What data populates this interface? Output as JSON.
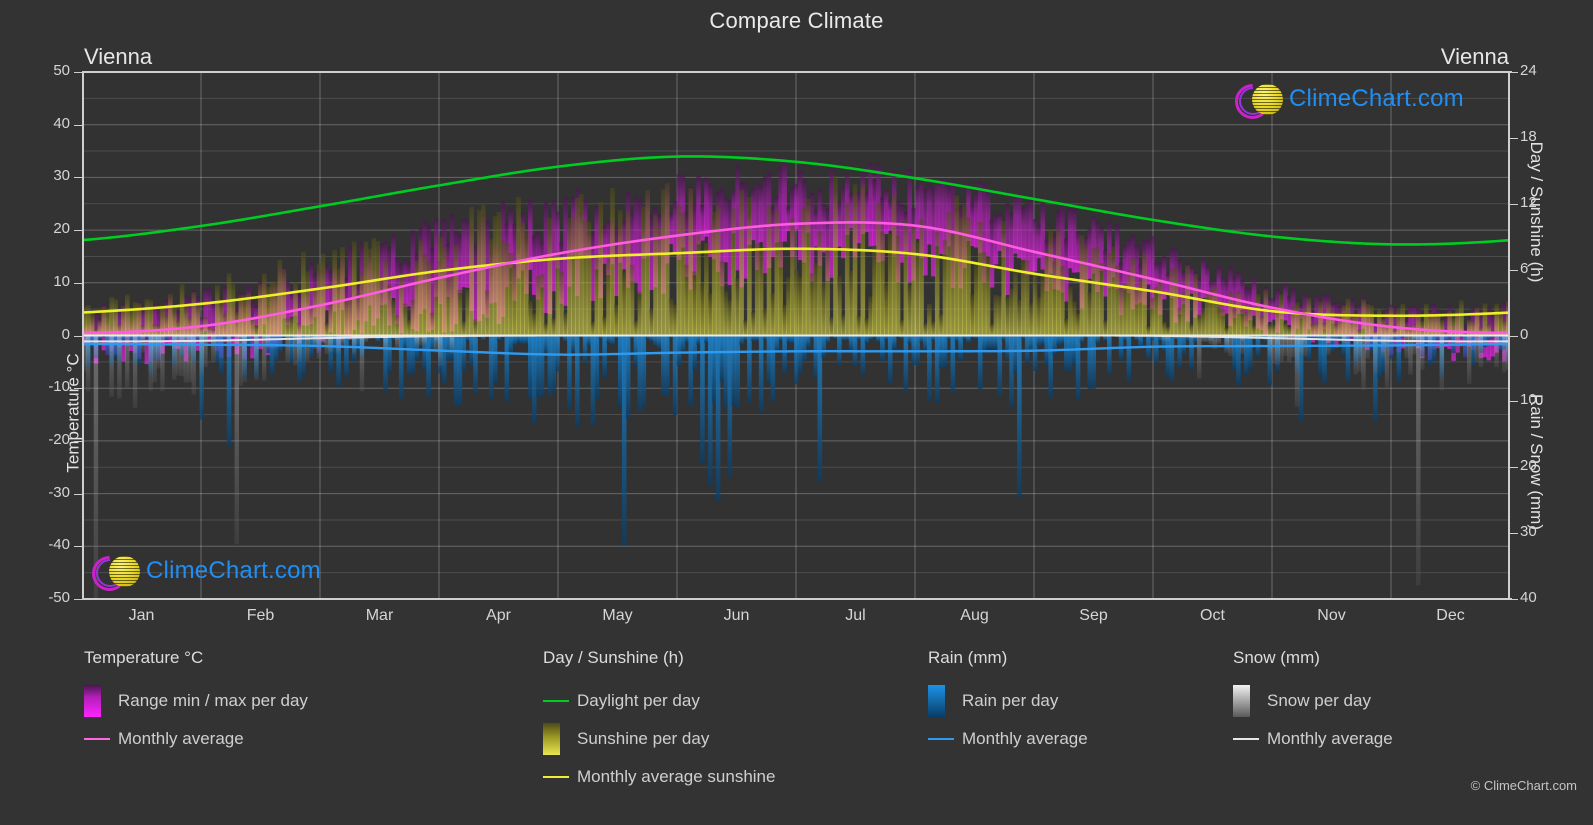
{
  "header": {
    "title": "Compare Climate",
    "city_left": "Vienna",
    "city_right": "Vienna"
  },
  "axes": {
    "left_label": "Temperature °C",
    "right_label_top": "Day / Sunshine (h)",
    "right_label_bottom": "Rain / Snow (mm)",
    "left_ticks": [
      "50",
      "40",
      "30",
      "20",
      "10",
      "0",
      "-10",
      "-20",
      "-30",
      "-40",
      "-50"
    ],
    "right_ticks_top": [
      "24",
      "18",
      "12",
      "6",
      "0"
    ],
    "right_ticks_bottom": [
      "0",
      "10",
      "20",
      "30",
      "40"
    ],
    "x_ticks": [
      "Jan",
      "Feb",
      "Mar",
      "Apr",
      "May",
      "Jun",
      "Jul",
      "Aug",
      "Sep",
      "Oct",
      "Nov",
      "Dec"
    ]
  },
  "legend": {
    "groups": [
      {
        "title": "Temperature °C",
        "items": [
          {
            "label": "Range min / max per day",
            "key": "swatch",
            "color": "#ff00ff"
          },
          {
            "label": "Monthly average",
            "key": "line",
            "color": "#ff66e0"
          }
        ]
      },
      {
        "title": "Day / Sunshine (h)",
        "items": [
          {
            "label": "Daylight per day",
            "key": "line",
            "color": "#00cc22"
          },
          {
            "label": "Sunshine per day",
            "key": "swatch",
            "color": "#ecea44"
          },
          {
            "label": "Monthly average sunshine",
            "key": "line",
            "color": "#eeee33"
          }
        ]
      },
      {
        "title": "Rain (mm)",
        "items": [
          {
            "label": "Rain per day",
            "key": "swatch",
            "color": "#1a8fe0"
          },
          {
            "label": "Monthly average",
            "key": "line",
            "color": "#2f9bf0"
          }
        ]
      },
      {
        "title": "Snow (mm)",
        "items": [
          {
            "label": "Snow per day",
            "key": "swatch",
            "color": "#e8e8e8"
          },
          {
            "label": "Monthly average",
            "key": "line",
            "color": "#e6e6e6"
          }
        ]
      }
    ]
  },
  "branding": {
    "logo_text": "ClimeChart.com",
    "copyright": "© ClimeChart.com"
  },
  "chart_data": {
    "type": "line",
    "title": "Compare Climate",
    "subtitle": "Vienna",
    "xlabel": "",
    "ylabel": "Temperature °C",
    "ylabel_right_top": "Day / Sunshine (h)",
    "ylabel_right_bottom": "Rain / Snow (mm)",
    "ylim": [
      -50,
      50
    ],
    "ylim_right_hours": [
      0,
      24
    ],
    "ylim_right_mm": [
      0,
      40
    ],
    "grid": true,
    "legend_position": "below",
    "categories": [
      "Jan",
      "Feb",
      "Mar",
      "Apr",
      "May",
      "Jun",
      "Jul",
      "Aug",
      "Sep",
      "Oct",
      "Nov",
      "Dec"
    ],
    "series": [
      {
        "name": "Daylight per day",
        "unit": "h",
        "color": "#00cc22",
        "axis": "right_hours",
        "values": [
          8.7,
          10.0,
          11.8,
          13.7,
          15.4,
          16.3,
          15.8,
          14.3,
          12.4,
          10.5,
          9.0,
          8.3
        ]
      },
      {
        "name": "Monthly average sunshine",
        "unit": "h",
        "color": "#eeee33",
        "axis": "right_hours",
        "values": [
          2.1,
          2.9,
          4.3,
          5.9,
          7.0,
          7.5,
          7.9,
          7.4,
          5.6,
          4.0,
          2.2,
          1.8
        ]
      },
      {
        "name": "Monthly average temperature",
        "unit": "°C",
        "color": "#ff66e0",
        "axis": "left",
        "values": [
          0.5,
          1.8,
          5.8,
          11.0,
          15.6,
          19.0,
          21.2,
          20.8,
          15.8,
          10.6,
          5.2,
          1.6
        ]
      },
      {
        "name": "Rain monthly average",
        "unit": "mm",
        "color": "#2f9bf0",
        "axis": "right_mm",
        "values": [
          1.3,
          1.4,
          1.6,
          2.3,
          2.9,
          2.6,
          2.4,
          2.4,
          2.3,
          1.7,
          1.6,
          1.5
        ]
      },
      {
        "name": "Snow monthly average",
        "unit": "mm",
        "color": "#e6e6e6",
        "axis": "right_mm",
        "values": [
          0.9,
          0.8,
          0.4,
          0.1,
          0.0,
          0.0,
          0.0,
          0.0,
          0.0,
          0.05,
          0.4,
          0.8
        ]
      }
    ],
    "bands": [
      {
        "name": "Range min / max per day (temperature)",
        "color": "#ff00ff",
        "axis": "left",
        "min": [
          -3.0,
          -2.2,
          0.9,
          5.0,
          9.6,
          13.1,
          15.1,
          14.8,
          10.6,
          6.3,
          2.0,
          -1.5
        ],
        "max": [
          3.1,
          5.0,
          10.4,
          16.5,
          21.2,
          24.6,
          26.9,
          26.6,
          20.7,
          14.6,
          7.6,
          3.8
        ]
      },
      {
        "name": "Sunshine per day",
        "color": "#ecea44",
        "axis": "right_hours",
        "min": [
          0,
          0,
          0,
          0,
          0,
          0,
          0,
          0,
          0,
          0,
          0,
          0
        ],
        "max": [
          2.1,
          2.9,
          4.3,
          5.9,
          7.0,
          7.5,
          7.9,
          7.4,
          5.6,
          4.0,
          2.2,
          1.8
        ]
      }
    ]
  }
}
